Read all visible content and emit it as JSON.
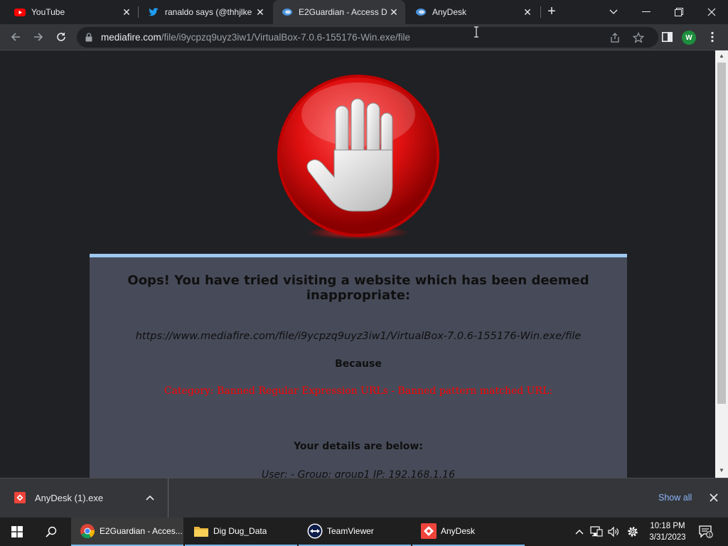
{
  "tabs": [
    {
      "title": "YouTube",
      "icon": "youtube-icon"
    },
    {
      "title": "ranaldo says (@thhjlke",
      "icon": "twitter-icon"
    },
    {
      "title": "E2Guardian - Access D",
      "icon": "anydesk-tab-icon"
    },
    {
      "title": "AnyDesk",
      "icon": "anydesk-tab-icon"
    }
  ],
  "address_bar": {
    "host": "mediafire.com",
    "path": "/file/i9ycpzq9uyz3iw1/VirtualBox-7.0.6-155176-Win.exe/file"
  },
  "profile_initial": "W",
  "block_page": {
    "heading": "Oops! You have tried visiting a website which has been deemed inappropriate:",
    "url": "https://www.mediafire.com/file/i9ycpzq9uyz3iw1/VirtualBox-7.0.6-155176-Win.exe/file",
    "because": "Because",
    "reason": "Category: Banned Regular Expression URLs - Banned pattern matched URL:",
    "details_title": "Your details are below:",
    "details": "User: -   Group: group1   IP: 192.168.1.16"
  },
  "download_bar": {
    "file_name": "AnyDesk (1).exe",
    "show_all": "Show all"
  },
  "taskbar": {
    "apps": [
      {
        "label": "E2Guardian - Acces...",
        "icon": "chrome-icon",
        "state": "active"
      },
      {
        "label": "Dig Dug_Data",
        "icon": "folder-icon",
        "state": "open"
      },
      {
        "label": "TeamViewer",
        "icon": "teamviewer-icon",
        "state": "open"
      },
      {
        "label": "AnyDesk",
        "icon": "anydesk-icon",
        "state": "open"
      }
    ],
    "time": "10:18 PM",
    "date": "3/31/2023",
    "notification_count": "1"
  },
  "colors": {
    "reason_text": "#ff0000",
    "card_background": "#474b59",
    "card_top_border": "#9ec9f0",
    "link_blue": "#8ab4f8"
  }
}
